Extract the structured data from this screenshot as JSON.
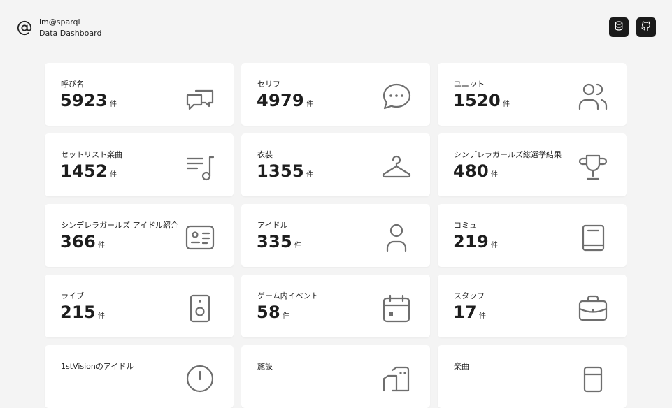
{
  "header": {
    "brand_line1": "im@sparql",
    "brand_line2": "Data Dashboard",
    "brand_icon": "at-sign-icon",
    "buttons": [
      {
        "icon": "database-icon"
      },
      {
        "icon": "github-icon"
      }
    ]
  },
  "unit": "件",
  "cards": [
    {
      "label": "呼び名",
      "count": "5923",
      "icon": "chat-bubbles-icon"
    },
    {
      "label": "セリフ",
      "count": "4979",
      "icon": "speech-bubble-icon"
    },
    {
      "label": "ユニット",
      "count": "1520",
      "icon": "users-icon"
    },
    {
      "label": "セットリスト楽曲",
      "count": "1452",
      "icon": "music-list-icon"
    },
    {
      "label": "衣装",
      "count": "1355",
      "icon": "hanger-icon"
    },
    {
      "label": "シンデレラガールズ総選挙結果",
      "count": "480",
      "icon": "trophy-icon"
    },
    {
      "label": "シンデレラガールズ アイドル紹介",
      "count": "366",
      "icon": "id-card-icon"
    },
    {
      "label": "アイドル",
      "count": "335",
      "icon": "user-icon"
    },
    {
      "label": "コミュ",
      "count": "219",
      "icon": "book-icon"
    },
    {
      "label": "ライブ",
      "count": "215",
      "icon": "speaker-icon"
    },
    {
      "label": "ゲーム内イベント",
      "count": "58",
      "icon": "calendar-icon"
    },
    {
      "label": "スタッフ",
      "count": "17",
      "icon": "briefcase-icon"
    },
    {
      "label": "1stVisionのアイドル",
      "count": "",
      "icon": "clock-icon"
    },
    {
      "label": "施設",
      "count": "",
      "icon": "building-icon"
    },
    {
      "label": "楽曲",
      "count": "",
      "icon": "music-icon"
    }
  ]
}
